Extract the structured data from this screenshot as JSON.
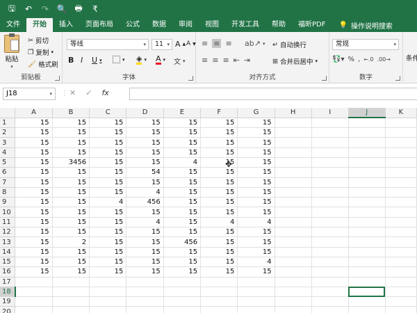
{
  "quick_access": [
    {
      "icon": "save-icon",
      "glyph": "🖫"
    },
    {
      "icon": "undo-icon",
      "glyph": "↶"
    },
    {
      "icon": "redo-icon",
      "glyph": "↷"
    },
    {
      "icon": "print-preview-icon",
      "glyph": "🔍"
    },
    {
      "icon": "quick-print-icon",
      "glyph": "🖶"
    },
    {
      "icon": "customize-icon",
      "glyph": "₹"
    }
  ],
  "menu_tabs": [
    "文件",
    "开始",
    "插入",
    "页面布局",
    "公式",
    "数据",
    "审阅",
    "视图",
    "开发工具",
    "帮助",
    "福昕PDF"
  ],
  "active_tab": "开始",
  "tell_me": "操作说明搜索",
  "ribbon": {
    "clipboard": {
      "paste": "粘贴",
      "cut": "剪切",
      "copy": "复制",
      "format_painter": "格式刷",
      "label": "剪贴板"
    },
    "font": {
      "name": "等线",
      "size": "11",
      "grow": "A",
      "shrink": "A",
      "bold": "B",
      "italic": "I",
      "underline": "U",
      "phonetic": "文",
      "label": "字体"
    },
    "alignment": {
      "wrap": "自动换行",
      "merge": "合并后居中",
      "label": "对齐方式"
    },
    "number": {
      "format": "常规",
      "label": "数字",
      "percent": "%",
      "comma": ","
    },
    "styles_partial": "条件"
  },
  "formula_bar": {
    "name_box": "J18",
    "cancel": "✕",
    "enter": "✓",
    "fx": "fx",
    "value": ""
  },
  "columns": [
    "A",
    "B",
    "C",
    "D",
    "E",
    "F",
    "G",
    "H",
    "I",
    "J",
    "K"
  ],
  "selected_column": "J",
  "selected_row": 18,
  "rows": [
    {
      "n": "1",
      "cells": [
        "15",
        "15",
        "15",
        "15",
        "15",
        "15",
        "15",
        "",
        "",
        "",
        ""
      ]
    },
    {
      "n": "2",
      "cells": [
        "15",
        "15",
        "15",
        "15",
        "15",
        "15",
        "15",
        "",
        "",
        "",
        ""
      ]
    },
    {
      "n": "3",
      "cells": [
        "15",
        "15",
        "15",
        "15",
        "15",
        "15",
        "15",
        "",
        "",
        "",
        ""
      ]
    },
    {
      "n": "4",
      "cells": [
        "15",
        "15",
        "15",
        "15",
        "15",
        "15",
        "15",
        "",
        "",
        "",
        ""
      ]
    },
    {
      "n": "5",
      "cells": [
        "15",
        "3456",
        "15",
        "15",
        "4",
        "15",
        "15",
        "",
        "",
        "",
        ""
      ]
    },
    {
      "n": "6",
      "cells": [
        "15",
        "15",
        "15",
        "54",
        "15",
        "15",
        "15",
        "",
        "",
        "",
        ""
      ]
    },
    {
      "n": "7",
      "cells": [
        "15",
        "15",
        "15",
        "15",
        "15",
        "15",
        "15",
        "",
        "",
        "",
        ""
      ]
    },
    {
      "n": "8",
      "cells": [
        "15",
        "15",
        "15",
        "4",
        "15",
        "15",
        "15",
        "",
        "",
        "",
        ""
      ]
    },
    {
      "n": "9",
      "cells": [
        "15",
        "15",
        "4",
        "456",
        "15",
        "15",
        "15",
        "",
        "",
        "",
        ""
      ]
    },
    {
      "n": "10",
      "cells": [
        "15",
        "15",
        "15",
        "15",
        "15",
        "15",
        "15",
        "",
        "",
        "",
        ""
      ]
    },
    {
      "n": "11",
      "cells": [
        "15",
        "15",
        "15",
        "4",
        "15",
        "4",
        "4",
        "",
        "",
        "",
        ""
      ]
    },
    {
      "n": "12",
      "cells": [
        "15",
        "15",
        "15",
        "15",
        "15",
        "15",
        "15",
        "",
        "",
        "",
        ""
      ]
    },
    {
      "n": "13",
      "cells": [
        "15",
        "2",
        "15",
        "15",
        "456",
        "15",
        "15",
        "",
        "",
        "",
        ""
      ]
    },
    {
      "n": "14",
      "cells": [
        "15",
        "15",
        "15",
        "15",
        "15",
        "15",
        "15",
        "",
        "",
        "",
        ""
      ]
    },
    {
      "n": "15",
      "cells": [
        "15",
        "15",
        "15",
        "15",
        "15",
        "15",
        "4",
        "",
        "",
        "",
        ""
      ]
    },
    {
      "n": "16",
      "cells": [
        "15",
        "15",
        "15",
        "15",
        "15",
        "15",
        "15",
        "",
        "",
        "",
        ""
      ]
    },
    {
      "n": "17",
      "cells": [
        "",
        "",
        "",
        "",
        "",
        "",
        "",
        "",
        "",
        "",
        ""
      ]
    },
    {
      "n": "18",
      "cells": [
        "",
        "",
        "",
        "",
        "",
        "",
        "",
        "",
        "",
        "",
        ""
      ]
    },
    {
      "n": "19",
      "cells": [
        "",
        "",
        "",
        "",
        "",
        "",
        "",
        "",
        "",
        "",
        ""
      ]
    },
    {
      "n": "20",
      "cells": [
        "",
        "",
        "",
        "",
        "",
        "",
        "",
        "",
        "",
        "",
        ""
      ]
    }
  ],
  "colors": {
    "excel_green": "#217346",
    "fill_yellow": "#ffd800",
    "font_red": "#e81123"
  }
}
